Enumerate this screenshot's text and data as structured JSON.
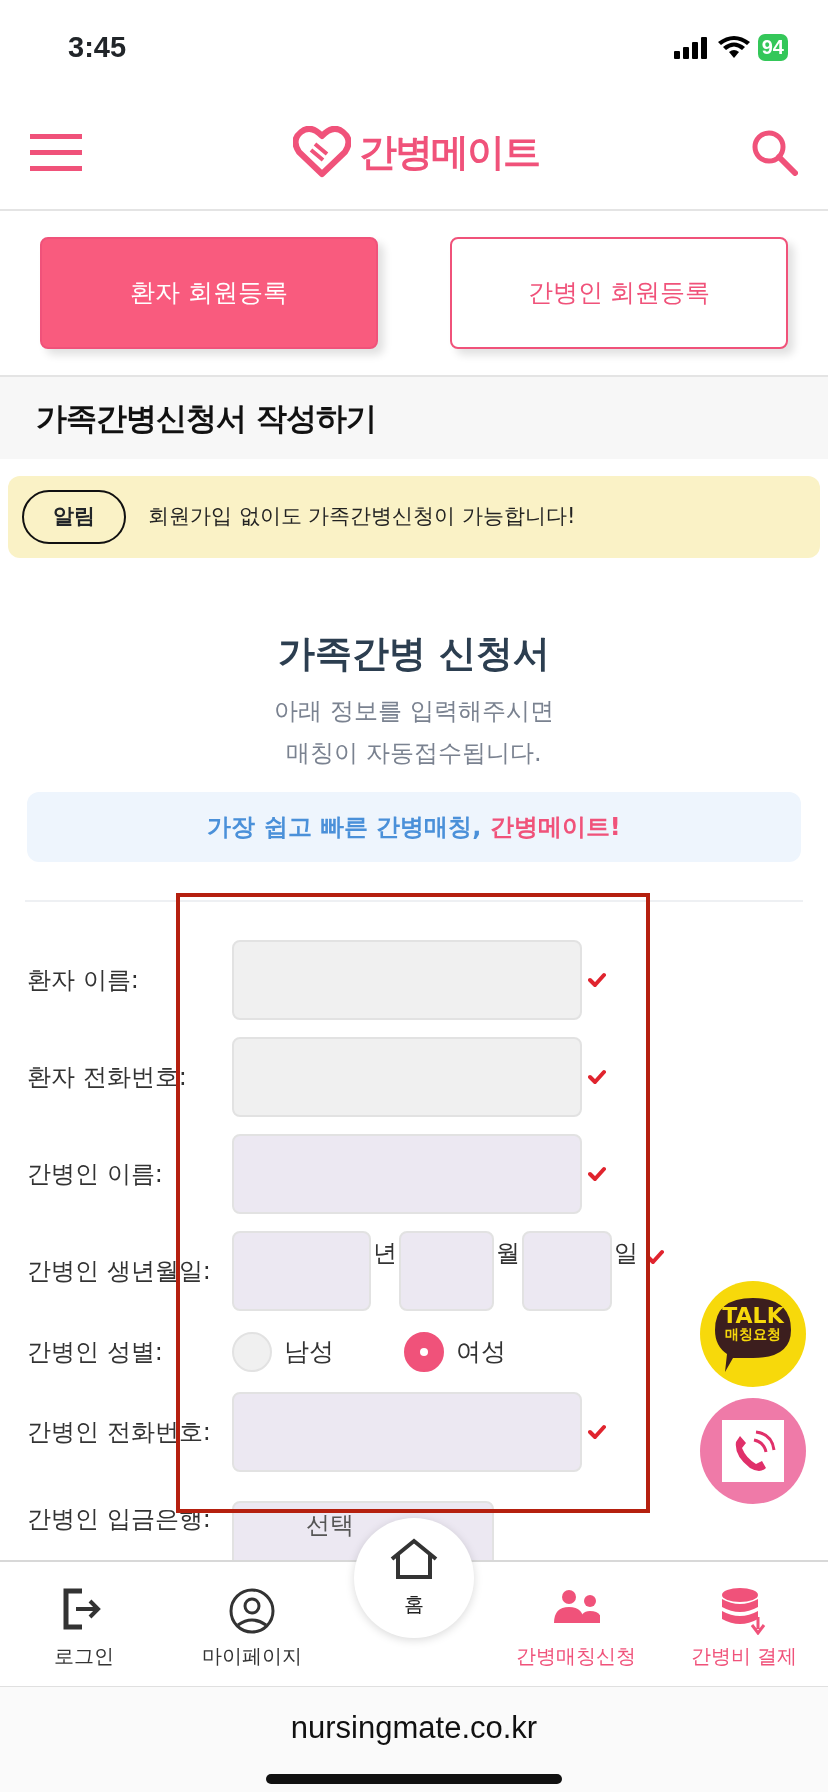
{
  "status_bar": {
    "time": "3:45",
    "battery": "94"
  },
  "header": {
    "logo": "간병메이트"
  },
  "register_tabs": [
    {
      "label": "환자 회원등록",
      "selected": true
    },
    {
      "label": "간병인 회원등록",
      "selected": false
    }
  ],
  "page_title": "가족간병신청서 작성하기",
  "notice": {
    "badge": "알림",
    "text": "회원가입 없이도 가족간병신청이 가능합니다!"
  },
  "form": {
    "title": "가족간병 신청서",
    "subtitle": [
      "아래 정보를 입력해주시면",
      "매칭이 자동접수됩니다."
    ],
    "banner": {
      "lead": "가장 쉽고 빠른 간병매칭, ",
      "brand": "간병메이트!"
    },
    "rows": [
      {
        "kind": "text",
        "label": "환자 이름:",
        "color": "#f0f0f0",
        "required": true
      },
      {
        "kind": "text",
        "label": "환자 전화번호:",
        "color": "#f0f0f0",
        "required": true
      },
      {
        "kind": "text",
        "label": "간병인 이름:",
        "color": "#ece8f2",
        "required": true
      },
      {
        "kind": "date",
        "label": "간병인 생년월일:",
        "color": "#ece8f2",
        "required": true,
        "units": [
          "년",
          "월",
          "일"
        ]
      },
      {
        "kind": "radio",
        "label": "간병인 성별:",
        "required": false,
        "options": [
          {
            "label": "남성",
            "selected": false
          },
          {
            "label": "여성",
            "selected": true
          }
        ]
      },
      {
        "kind": "text",
        "label": "간병인 전화번호:",
        "color": "#ece8f2",
        "required": true
      },
      {
        "kind": "select",
        "label": "간병인 입금은행:",
        "color": "#ece8f2",
        "value": "선택"
      }
    ]
  },
  "floating_buttons": [
    {
      "kind": "talk",
      "lines": [
        "TALK",
        "매칭요청"
      ]
    },
    {
      "kind": "phone"
    }
  ],
  "bottom_nav": [
    {
      "kind": "logout",
      "label": "로그인",
      "color": "#333333",
      "raised": false
    },
    {
      "kind": "person",
      "label": "마이페이지",
      "color": "#333333",
      "raised": false
    },
    {
      "kind": "home",
      "label": "홈",
      "color": "#222222",
      "raised": true
    },
    {
      "kind": "people",
      "label": "간병매칭신청",
      "color": "#f0527a",
      "raised": false
    },
    {
      "kind": "payment",
      "label": "간병비 결제",
      "color": "#f0527a",
      "raised": false
    }
  ],
  "url_bar": {
    "url": "nursingmate.co.kr"
  }
}
